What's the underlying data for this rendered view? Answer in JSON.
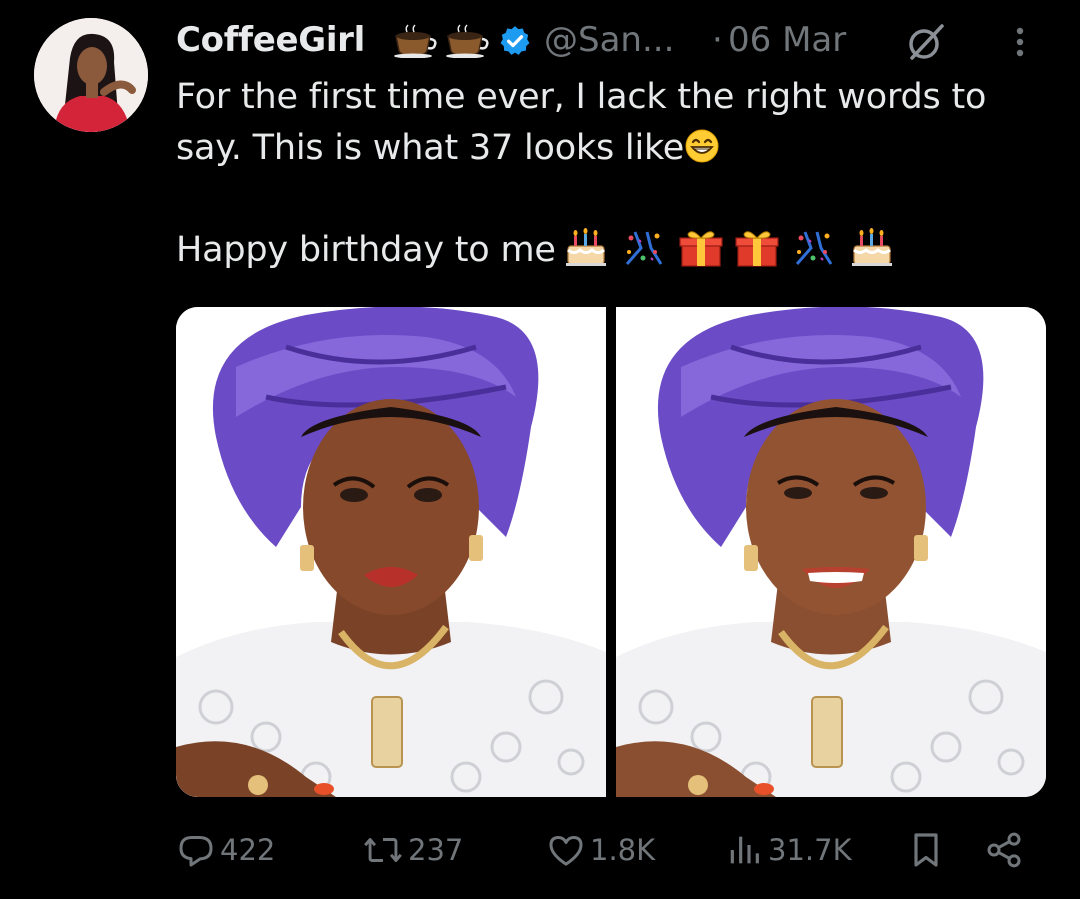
{
  "tweet": {
    "author": {
      "display_name": "CoffeeGirl",
      "name_emojis": [
        "coffee-cup-icon",
        "coffee-cup-icon"
      ],
      "verified": true,
      "handle": "@San...",
      "separator": "·",
      "date": "06 Mar"
    },
    "text_lines": [
      "For the first time ever, I lack the right words to",
      "say. This is what 37 looks like",
      "Happy birthday to me"
    ],
    "inline_emojis": {
      "line2_end": "grinning-face-icon",
      "line3_end": [
        "birthday-cake-icon",
        "confetti-icon",
        "gift-icon",
        "gift-icon",
        "confetti-icon",
        "birthday-cake-icon"
      ]
    },
    "media": [
      {
        "alt": "woman-in-purple-gele-portrait-1"
      },
      {
        "alt": "woman-in-purple-gele-portrait-2"
      }
    ],
    "actions": {
      "replies": "422",
      "reposts": "237",
      "likes": "1.8K",
      "views": "31.7K"
    }
  },
  "colors": {
    "background": "#000000",
    "text_primary": "#e7e9ea",
    "text_secondary": "#71767b",
    "verified_blue": "#1d9bf0",
    "gele_purple": "#6b4bc6"
  }
}
